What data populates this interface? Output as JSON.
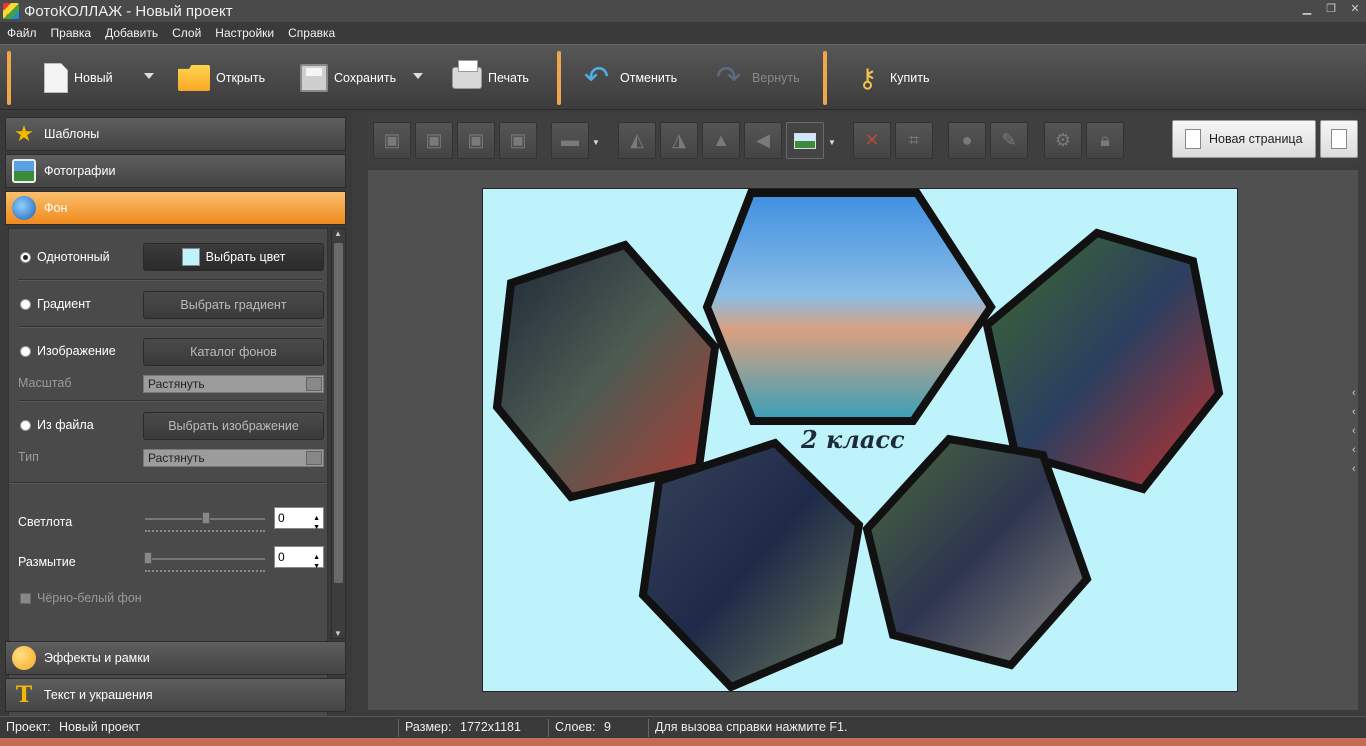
{
  "window": {
    "title": "ФотоКОЛЛАЖ - Новый проект"
  },
  "menu": [
    "Файл",
    "Правка",
    "Добавить",
    "Слой",
    "Настройки",
    "Справка"
  ],
  "toolbar": {
    "new": "Новый",
    "open": "Открыть",
    "save": "Сохранить",
    "print": "Печать",
    "undo": "Отменить",
    "redo": "Вернуть",
    "buy": "Купить"
  },
  "sidebar": {
    "templates": "Шаблоны",
    "photos": "Фотографии",
    "background": "Фон",
    "effects": "Эффекты и рамки",
    "text": "Текст и украшения"
  },
  "background_panel": {
    "solid_label": "Однотонный",
    "choose_color": "Выбрать цвет",
    "selected_color": "#bff3fb",
    "gradient_label": "Градиент",
    "choose_gradient": "Выбрать градиент",
    "image_label": "Изображение",
    "catalog": "Каталог фонов",
    "scale_label": "Масштаб",
    "scale_value": "Растянуть",
    "file_label": "Из файла",
    "choose_image": "Выбрать изображение",
    "type_label": "Тип",
    "type_value": "Растянуть",
    "brightness_label": "Светлота",
    "brightness_value": "0",
    "blur_label": "Размытие",
    "blur_value": "0",
    "bw_label": "Чёрно-белый фон"
  },
  "page_controls": {
    "new_page": "Новая страница"
  },
  "canvas": {
    "caption": "2 класс",
    "background": "#bff3fb"
  },
  "status": {
    "project_label": "Проект:",
    "project_value": "Новый проект",
    "size_label": "Размер:",
    "size_value": "1772x1181",
    "layers_label": "Слоев:",
    "layers_value": "9",
    "hint": "Для вызова справки нажмите F1."
  },
  "colors": {
    "accent": "#f08a1c",
    "toolbar_separator": "#f0a64a"
  }
}
